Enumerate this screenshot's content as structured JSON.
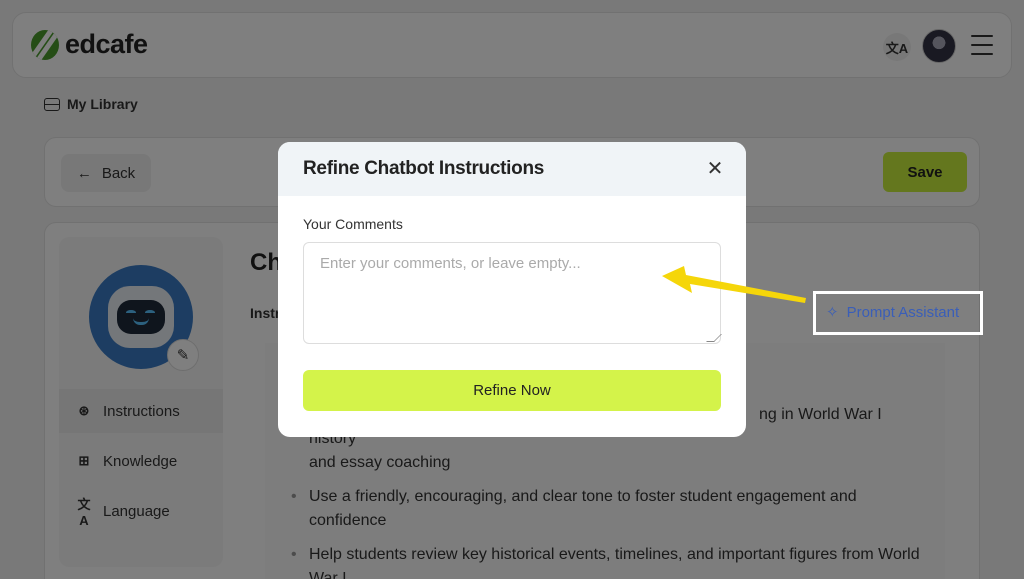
{
  "header": {
    "logo_text": "edcafe",
    "translate_icon": "translate-icon",
    "menu_icon": "menu-icon"
  },
  "nav": {
    "library_label": "My Library"
  },
  "toolbar": {
    "back_label": "Back",
    "save_label": "Save"
  },
  "sidebar": {
    "items": [
      {
        "label": "Instructions",
        "icon": "brain-icon"
      },
      {
        "label": "Knowledge",
        "icon": "book-icon"
      },
      {
        "label": "Language",
        "icon": "translate-icon"
      }
    ]
  },
  "content": {
    "title_partial": "Ch",
    "instructions_label_partial": "Instr",
    "bullets": [
      "Assist students by providing support and help in World War I history",
      "and essay coaching",
      "Use a friendly, encouraging, and clear tone to foster student engagement and confidence",
      "Help students review key historical events, timelines, and important figures from World War I"
    ],
    "bullet1_visible": "ng in World War I history",
    "bullet1_line2": "and essay coaching"
  },
  "prompt_assistant": {
    "label": "Prompt Assistant"
  },
  "modal": {
    "title": "Refine Chatbot Instructions",
    "comments_label": "Your Comments",
    "comments_placeholder": "Enter your comments, or leave empty...",
    "comments_value": "",
    "refine_button": "Refine Now"
  },
  "colors": {
    "accent_lime": "#d4f34a",
    "save_green": "#c9ef3c",
    "link_blue": "#3a5eb8",
    "arrow_yellow": "#f5d60a"
  }
}
